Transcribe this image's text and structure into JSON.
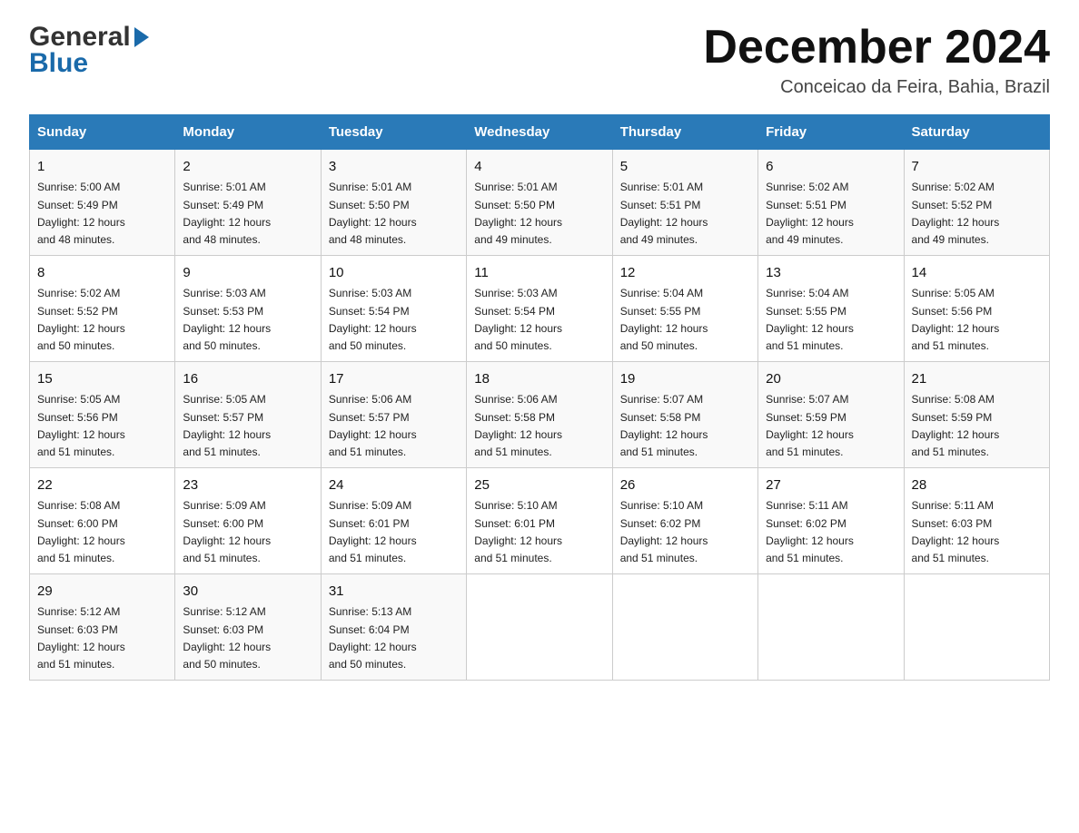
{
  "logo": {
    "general": "General",
    "blue": "Blue"
  },
  "title": "December 2024",
  "subtitle": "Conceicao da Feira, Bahia, Brazil",
  "days_of_week": [
    "Sunday",
    "Monday",
    "Tuesday",
    "Wednesday",
    "Thursday",
    "Friday",
    "Saturday"
  ],
  "weeks": [
    [
      {
        "day": "1",
        "sunrise": "5:00 AM",
        "sunset": "5:49 PM",
        "daylight": "12 hours and 48 minutes."
      },
      {
        "day": "2",
        "sunrise": "5:01 AM",
        "sunset": "5:49 PM",
        "daylight": "12 hours and 48 minutes."
      },
      {
        "day": "3",
        "sunrise": "5:01 AM",
        "sunset": "5:50 PM",
        "daylight": "12 hours and 48 minutes."
      },
      {
        "day": "4",
        "sunrise": "5:01 AM",
        "sunset": "5:50 PM",
        "daylight": "12 hours and 49 minutes."
      },
      {
        "day": "5",
        "sunrise": "5:01 AM",
        "sunset": "5:51 PM",
        "daylight": "12 hours and 49 minutes."
      },
      {
        "day": "6",
        "sunrise": "5:02 AM",
        "sunset": "5:51 PM",
        "daylight": "12 hours and 49 minutes."
      },
      {
        "day": "7",
        "sunrise": "5:02 AM",
        "sunset": "5:52 PM",
        "daylight": "12 hours and 49 minutes."
      }
    ],
    [
      {
        "day": "8",
        "sunrise": "5:02 AM",
        "sunset": "5:52 PM",
        "daylight": "12 hours and 50 minutes."
      },
      {
        "day": "9",
        "sunrise": "5:03 AM",
        "sunset": "5:53 PM",
        "daylight": "12 hours and 50 minutes."
      },
      {
        "day": "10",
        "sunrise": "5:03 AM",
        "sunset": "5:54 PM",
        "daylight": "12 hours and 50 minutes."
      },
      {
        "day": "11",
        "sunrise": "5:03 AM",
        "sunset": "5:54 PM",
        "daylight": "12 hours and 50 minutes."
      },
      {
        "day": "12",
        "sunrise": "5:04 AM",
        "sunset": "5:55 PM",
        "daylight": "12 hours and 50 minutes."
      },
      {
        "day": "13",
        "sunrise": "5:04 AM",
        "sunset": "5:55 PM",
        "daylight": "12 hours and 51 minutes."
      },
      {
        "day": "14",
        "sunrise": "5:05 AM",
        "sunset": "5:56 PM",
        "daylight": "12 hours and 51 minutes."
      }
    ],
    [
      {
        "day": "15",
        "sunrise": "5:05 AM",
        "sunset": "5:56 PM",
        "daylight": "12 hours and 51 minutes."
      },
      {
        "day": "16",
        "sunrise": "5:05 AM",
        "sunset": "5:57 PM",
        "daylight": "12 hours and 51 minutes."
      },
      {
        "day": "17",
        "sunrise": "5:06 AM",
        "sunset": "5:57 PM",
        "daylight": "12 hours and 51 minutes."
      },
      {
        "day": "18",
        "sunrise": "5:06 AM",
        "sunset": "5:58 PM",
        "daylight": "12 hours and 51 minutes."
      },
      {
        "day": "19",
        "sunrise": "5:07 AM",
        "sunset": "5:58 PM",
        "daylight": "12 hours and 51 minutes."
      },
      {
        "day": "20",
        "sunrise": "5:07 AM",
        "sunset": "5:59 PM",
        "daylight": "12 hours and 51 minutes."
      },
      {
        "day": "21",
        "sunrise": "5:08 AM",
        "sunset": "5:59 PM",
        "daylight": "12 hours and 51 minutes."
      }
    ],
    [
      {
        "day": "22",
        "sunrise": "5:08 AM",
        "sunset": "6:00 PM",
        "daylight": "12 hours and 51 minutes."
      },
      {
        "day": "23",
        "sunrise": "5:09 AM",
        "sunset": "6:00 PM",
        "daylight": "12 hours and 51 minutes."
      },
      {
        "day": "24",
        "sunrise": "5:09 AM",
        "sunset": "6:01 PM",
        "daylight": "12 hours and 51 minutes."
      },
      {
        "day": "25",
        "sunrise": "5:10 AM",
        "sunset": "6:01 PM",
        "daylight": "12 hours and 51 minutes."
      },
      {
        "day": "26",
        "sunrise": "5:10 AM",
        "sunset": "6:02 PM",
        "daylight": "12 hours and 51 minutes."
      },
      {
        "day": "27",
        "sunrise": "5:11 AM",
        "sunset": "6:02 PM",
        "daylight": "12 hours and 51 minutes."
      },
      {
        "day": "28",
        "sunrise": "5:11 AM",
        "sunset": "6:03 PM",
        "daylight": "12 hours and 51 minutes."
      }
    ],
    [
      {
        "day": "29",
        "sunrise": "5:12 AM",
        "sunset": "6:03 PM",
        "daylight": "12 hours and 51 minutes."
      },
      {
        "day": "30",
        "sunrise": "5:12 AM",
        "sunset": "6:03 PM",
        "daylight": "12 hours and 50 minutes."
      },
      {
        "day": "31",
        "sunrise": "5:13 AM",
        "sunset": "6:04 PM",
        "daylight": "12 hours and 50 minutes."
      },
      null,
      null,
      null,
      null
    ]
  ],
  "labels": {
    "sunrise": "Sunrise:",
    "sunset": "Sunset:",
    "daylight": "Daylight:"
  },
  "accent_color": "#2a7ab8"
}
